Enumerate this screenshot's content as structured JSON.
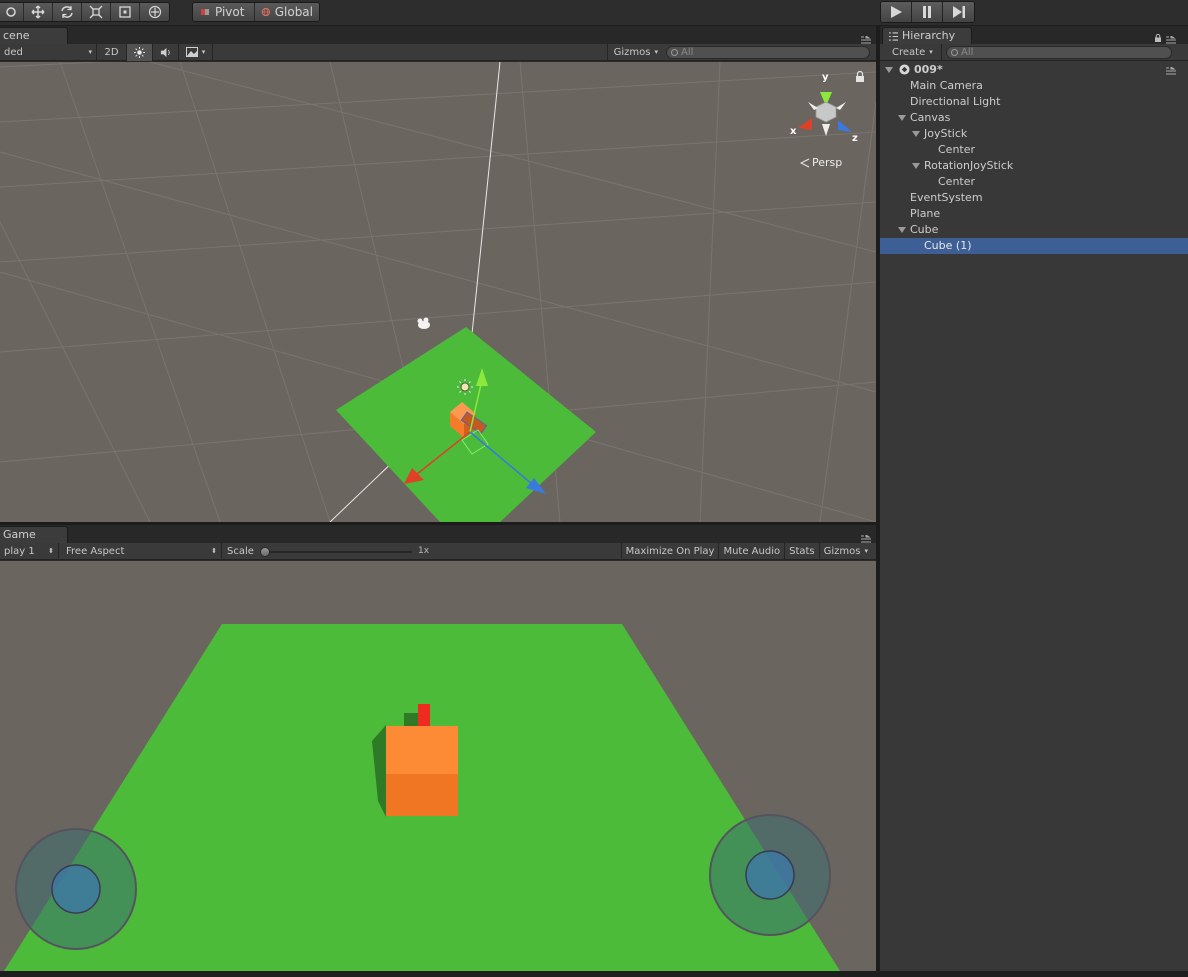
{
  "toolbar": {
    "pivot_label": "Pivot",
    "global_label": "Global"
  },
  "scene_panel": {
    "tab_label": "cene",
    "shading_mode": "ded",
    "mode_2d_label": "2D",
    "gizmos_label": "Gizmos",
    "search_placeholder": "All",
    "persp_label": "Persp",
    "axis_labels": {
      "x": "x",
      "y": "y",
      "z": "z"
    }
  },
  "game_panel": {
    "tab_label": "Game",
    "display_label": "play 1",
    "aspect_label": "Free Aspect",
    "scale_label": "Scale",
    "scale_value": "1x",
    "maximize_label": "Maximize On Play",
    "mute_label": "Mute Audio",
    "stats_label": "Stats",
    "gizmos_label": "Gizmos"
  },
  "hierarchy": {
    "tab_label": "Hierarchy",
    "create_label": "Create",
    "search_placeholder": "All",
    "scene_name": "009*",
    "items": [
      {
        "label": "Main Camera"
      },
      {
        "label": "Directional Light"
      },
      {
        "label": "Canvas"
      },
      {
        "label": "JoyStick"
      },
      {
        "label": "Center"
      },
      {
        "label": "RotationJoyStick"
      },
      {
        "label": "Center"
      },
      {
        "label": "EventSystem"
      },
      {
        "label": "Plane"
      },
      {
        "label": "Cube"
      },
      {
        "label": "Cube (1)"
      }
    ]
  },
  "colors": {
    "selection": "#3e5f96",
    "plane_green": "#4cbb3a",
    "cube_orange": "#fb7e2c",
    "viewport_bg": "#6b6560"
  }
}
